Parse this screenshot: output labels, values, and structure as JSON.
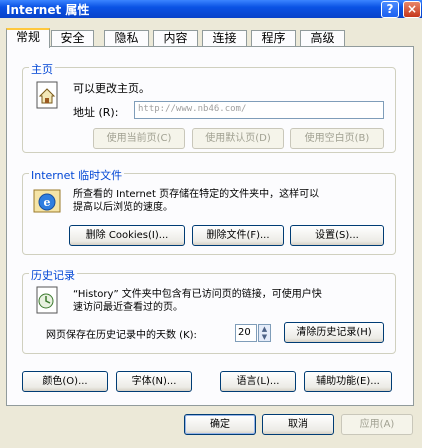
{
  "window": {
    "title": "Internet 属性"
  },
  "tabs": [
    "常规",
    "安全",
    "隐私",
    "内容",
    "连接",
    "程序",
    "高级"
  ],
  "homepage": {
    "group_title": "主页",
    "description": "可以更改主页。",
    "address_label": "地址 (R):",
    "address_value": "http://www.nb46.com/",
    "btn_current": "使用当前页(C)",
    "btn_default": "使用默认页(D)",
    "btn_blank": "使用空白页(B)"
  },
  "temp_files": {
    "group_title": "Internet 临时文件",
    "description_line1": "所查看的 Internet 页存储在特定的文件夹中，这样可以",
    "description_line2": "提高以后浏览的速度。",
    "btn_delete_cookies": "删除 Cookies(I)...",
    "btn_delete_files": "删除文件(F)...",
    "btn_settings": "设置(S)..."
  },
  "history": {
    "group_title": "历史记录",
    "description_line1": "“History” 文件夹中包含有已访问页的链接，可使用户快",
    "description_line2": "速访问最近查看过的页。",
    "days_label": "网页保存在历史记录中的天数 (K):",
    "days_value": "20",
    "btn_clear": "清除历史记录(H)"
  },
  "bottom_buttons": {
    "colors": "颜色(O)...",
    "fonts": "字体(N)...",
    "languages": "语言(L)...",
    "accessibility": "辅助功能(E)..."
  },
  "dialog_buttons": {
    "ok": "确定",
    "cancel": "取消",
    "apply": "应用(A)"
  }
}
